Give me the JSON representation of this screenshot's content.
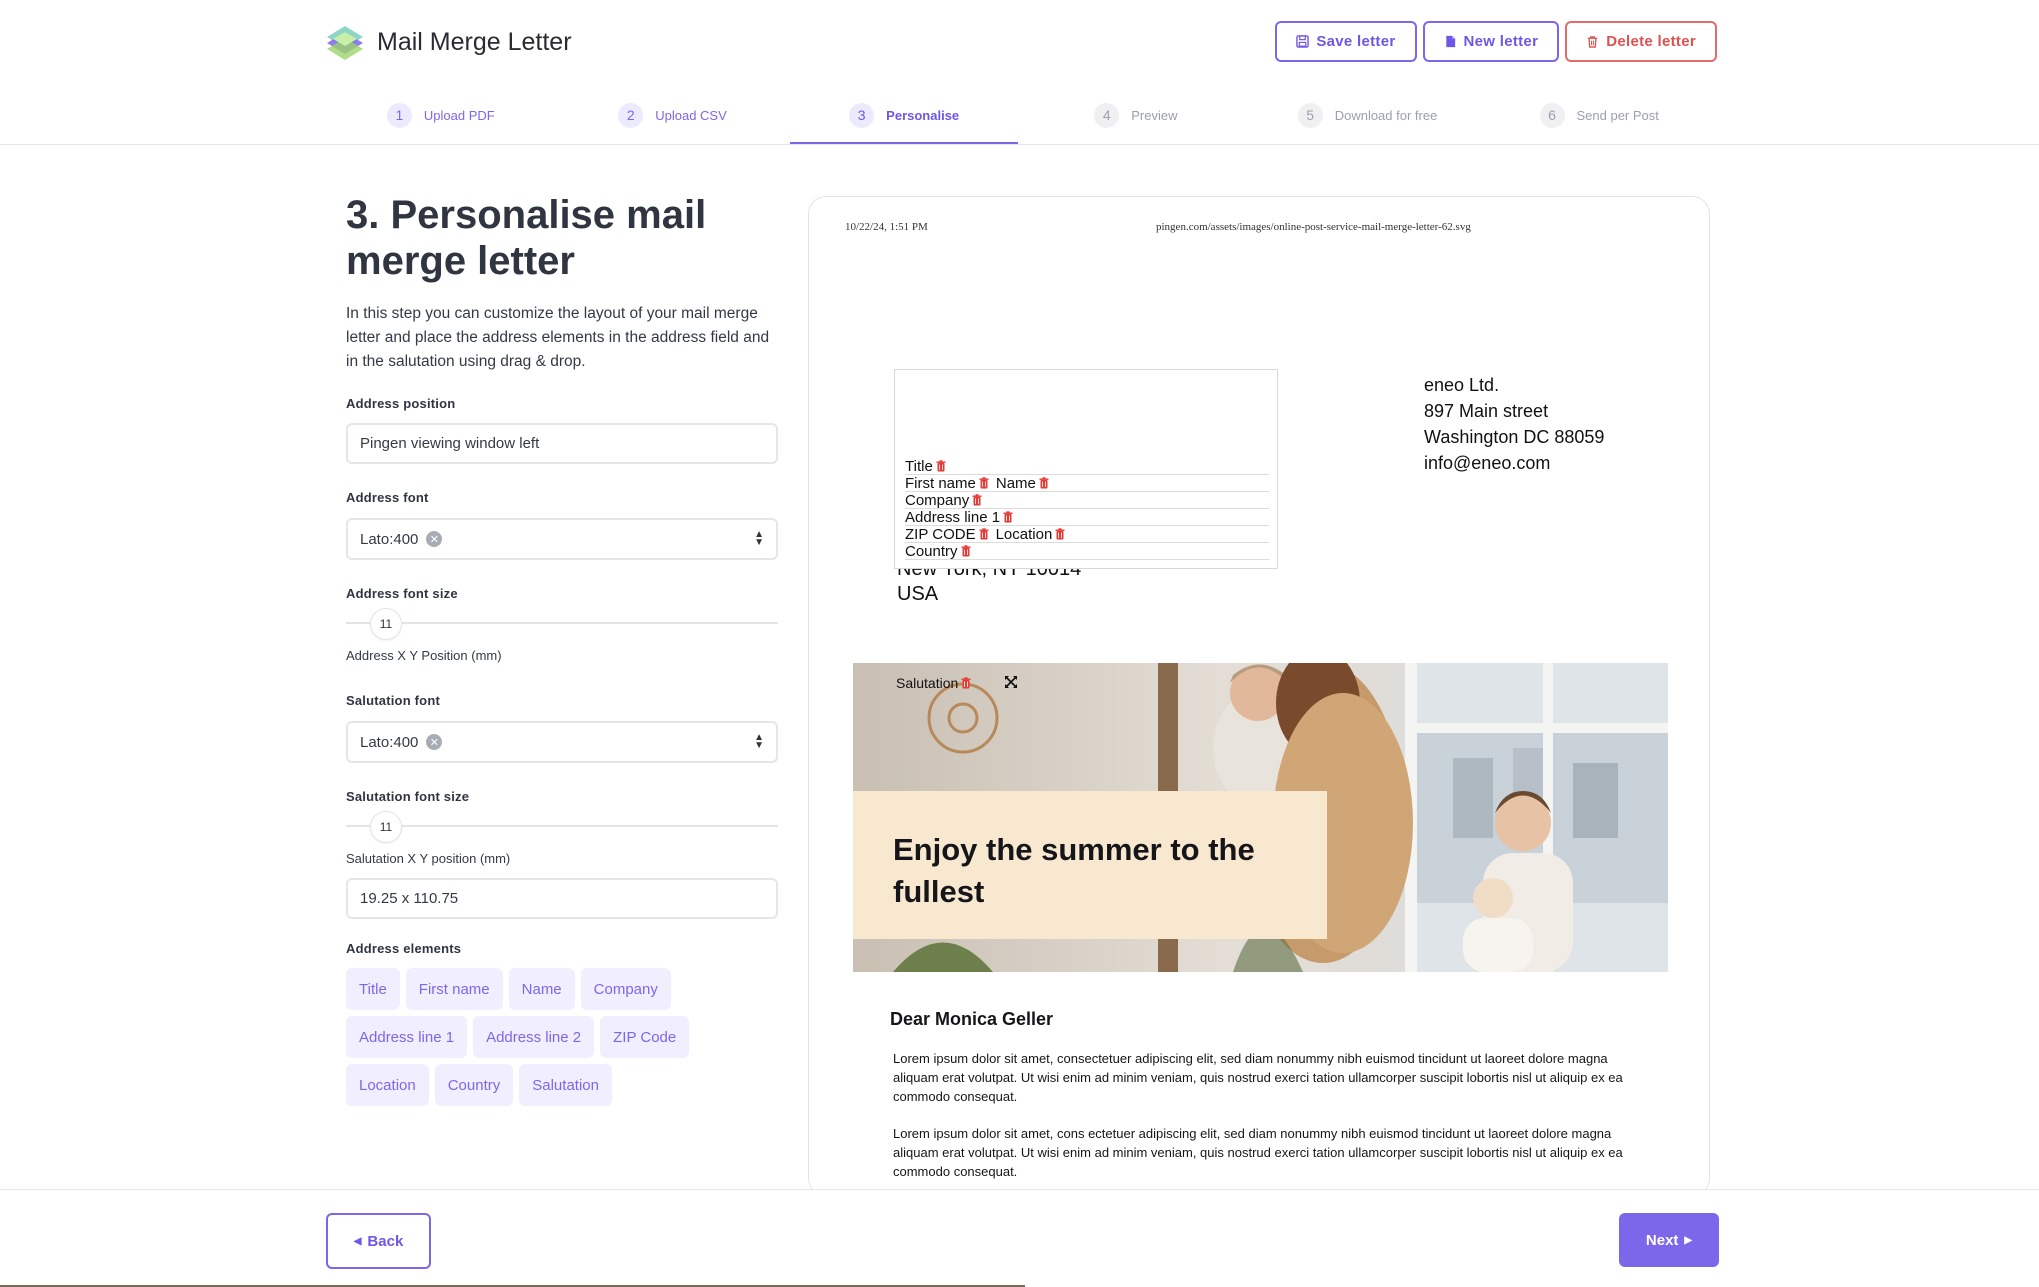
{
  "app": {
    "title": "Mail Merge Letter",
    "accent_color": "#7c67ea",
    "danger_color": "#e05050"
  },
  "actions": {
    "save": "Save letter",
    "new": "New letter",
    "delete": "Delete letter"
  },
  "steps": [
    {
      "num": "1",
      "label": "Upload PDF",
      "state": "done"
    },
    {
      "num": "2",
      "label": "Upload CSV",
      "state": "done"
    },
    {
      "num": "3",
      "label": "Personalise",
      "state": "active"
    },
    {
      "num": "4",
      "label": "Preview",
      "state": "todo"
    },
    {
      "num": "5",
      "label": "Download for free",
      "state": "todo"
    },
    {
      "num": "6",
      "label": "Send per Post",
      "state": "todo"
    }
  ],
  "panel": {
    "title": "3. Personalise mail merge letter",
    "intro": "In this step you can customize the layout of your mail merge letter and place the address elements in the address field and in the salutation using drag & drop.",
    "address_position_label": "Address position",
    "address_position_value": "Pingen viewing window left",
    "address_font_label": "Address font",
    "address_font_value": "Lato:400",
    "address_font_size_label": "Address font size",
    "address_font_size_value": "11",
    "address_xy_label": "Address X Y Position (mm)",
    "salutation_font_label": "Salutation font",
    "salutation_font_value": "Lato:400",
    "salutation_font_size_label": "Salutation font size",
    "salutation_font_size_value": "11",
    "salutation_xy_label": "Salutation X Y position (mm)",
    "salutation_xy_value": "19.25 x 110.75",
    "address_elements_label": "Address elements",
    "address_elements": [
      "Title",
      "First name",
      "Name",
      "Company",
      "Address line 1",
      "Address line 2",
      "ZIP Code",
      "Location",
      "Country",
      "Salutation"
    ]
  },
  "preview": {
    "print_date": "10/22/24, 1:51 PM",
    "print_url": "pingen.com/assets/images/online-post-service-mail-merge-letter-62.svg",
    "sender_lines": [
      "eneo Ltd.",
      "897 Main street",
      "Washington DC 88059",
      "info@eneo.com"
    ],
    "recipient_under": [
      "New York, NY 10014",
      "USA"
    ],
    "address_fields": {
      "title": "Title",
      "first_name": "First name",
      "name": "Name",
      "company": "Company",
      "address_line_1": "Address line 1",
      "zip_code": "ZIP CODE",
      "location": "Location",
      "country": "Country"
    },
    "salutation_tag": "Salutation",
    "hero_text": "Enjoy the summer to the fullest",
    "dear": "Dear Monica Geller",
    "paragraph1": "Lorem ipsum dolor sit amet, consectetuer adipiscing elit, sed diam nonummy nibh euismod tincidunt ut laoreet dolore magna aliquam erat volutpat. Ut wisi enim ad minim veniam, quis nostrud exerci tation ullamcorper suscipit lobortis nisl ut aliquip ex ea commodo consequat.",
    "paragraph2": "Lorem ipsum dolor sit amet, cons ectetuer adipiscing elit, sed diam nonummy nibh euismod tincidunt ut laoreet dolore magna aliquam erat volutpat. Ut wisi enim ad minim veniam, quis nostrud exerci tation ullamcorper suscipit lobortis nisl ut aliquip ex ea commodo consequat."
  },
  "footer": {
    "back": "Back",
    "next": "Next"
  }
}
